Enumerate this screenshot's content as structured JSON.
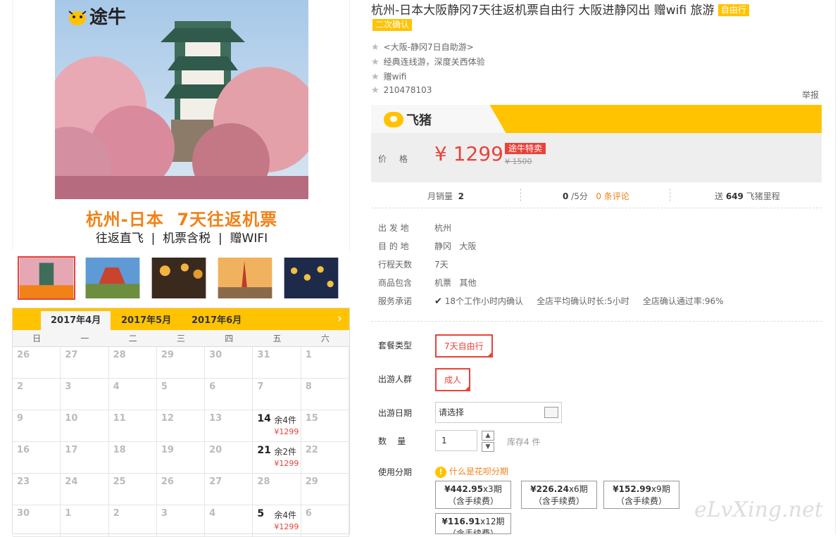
{
  "hero": {
    "logo": "途牛",
    "slogan": "杭州-日本  7天往返机票",
    "subline": "往返直飞  |  机票含税  |  赠WIFI"
  },
  "thumbs": [
    {
      "name": "castle"
    },
    {
      "name": "temple"
    },
    {
      "name": "street"
    },
    {
      "name": "tower"
    },
    {
      "name": "lanterns"
    }
  ],
  "calendar": {
    "tabs": [
      "2017年4月",
      "2017年5月",
      "2017年6月"
    ],
    "next": "›",
    "weekdays": [
      "日",
      "一",
      "二",
      "三",
      "四",
      "五",
      "六"
    ],
    "days": [
      {
        "d": "26"
      },
      {
        "d": "27"
      },
      {
        "d": "28"
      },
      {
        "d": "29"
      },
      {
        "d": "30"
      },
      {
        "d": "31"
      },
      {
        "d": "1"
      },
      {
        "d": "2"
      },
      {
        "d": "3"
      },
      {
        "d": "4"
      },
      {
        "d": "5"
      },
      {
        "d": "6"
      },
      {
        "d": "7"
      },
      {
        "d": "8"
      },
      {
        "d": "9"
      },
      {
        "d": "10"
      },
      {
        "d": "11"
      },
      {
        "d": "12"
      },
      {
        "d": "13"
      },
      {
        "d": "14",
        "rem": "余4件",
        "price": "¥1299"
      },
      {
        "d": "15"
      },
      {
        "d": "16"
      },
      {
        "d": "17"
      },
      {
        "d": "18"
      },
      {
        "d": "19"
      },
      {
        "d": "20"
      },
      {
        "d": "21",
        "rem": "余2件",
        "price": "¥1299"
      },
      {
        "d": "22"
      },
      {
        "d": "23"
      },
      {
        "d": "24"
      },
      {
        "d": "25"
      },
      {
        "d": "26"
      },
      {
        "d": "27"
      },
      {
        "d": "28"
      },
      {
        "d": "29"
      },
      {
        "d": "30"
      },
      {
        "d": "1"
      },
      {
        "d": "2"
      },
      {
        "d": "3"
      },
      {
        "d": "4"
      },
      {
        "d": "5",
        "rem": "余4件",
        "price": "¥1299"
      },
      {
        "d": "6"
      }
    ]
  },
  "product": {
    "title": "杭州-日本大阪静冈7天往返机票自由行 大阪进静冈出 赠wifi 旅游",
    "tag_free": "自由行",
    "tag_confirm": "二次确认",
    "features": [
      "<大阪-静冈7日自助游>",
      "经典连线游，深度关西体验",
      "赠wifi",
      "210478103"
    ],
    "report": "举报"
  },
  "brand": {
    "name": "飞猪"
  },
  "price": {
    "label": "价格",
    "current": "¥ 1299",
    "special": "途牛特卖",
    "original": "¥ 1500"
  },
  "stats": {
    "monthly_label": "月销量",
    "monthly_value": "2",
    "rating_value": "0",
    "rating_unit": "/5分",
    "reviews": "0 条评论",
    "miles_prefix": "送",
    "miles_value": "649",
    "miles_suffix": "飞猪里程"
  },
  "info": [
    {
      "k": "出 发 地",
      "v": "杭州"
    },
    {
      "k": "目 的 地",
      "v": "静冈   大阪"
    },
    {
      "k": "行程天数",
      "v": "7天"
    },
    {
      "k": "商品包含",
      "v": "机票   其他"
    },
    {
      "k": "服务承诺",
      "v": "18个工作小时内确认     全店平均确认时长:5小时     全店确认通过率:96%"
    }
  ],
  "options": {
    "package_label": "套餐类型",
    "package_value": "7天自由行",
    "crowd_label": "出游人群",
    "crowd_value": "成人",
    "date_label": "出游日期",
    "date_placeholder": "请选择",
    "qty_label": "数    量",
    "qty_value": "1",
    "stock": "库存4 件",
    "installment_label": "使用分期",
    "huabei": "什么是花呗分期"
  },
  "installments": [
    {
      "amount": "¥442.95",
      "period": "x3期",
      "note": "（含手续费）"
    },
    {
      "amount": "¥226.24",
      "period": "x6期",
      "note": "（含手续费）"
    },
    {
      "amount": "¥152.99",
      "period": "x9期",
      "note": "（含手续费）"
    },
    {
      "amount": "¥116.91",
      "period": "x12期",
      "note": "（含手续费）"
    }
  ],
  "watermark": "eLvXing.net"
}
